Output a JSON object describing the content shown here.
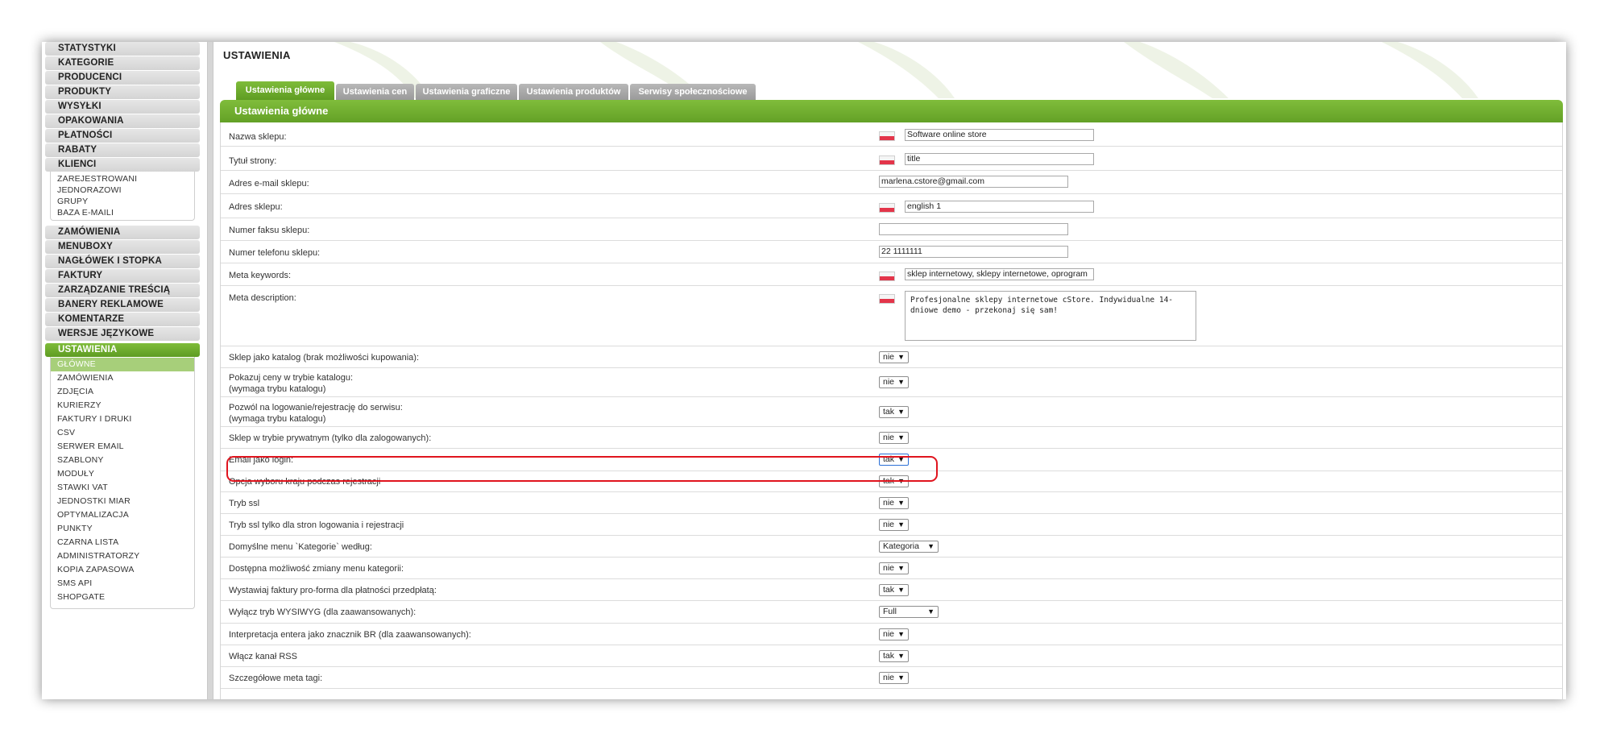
{
  "sidebar": {
    "sections_top": [
      "STATYSTYKI",
      "KATEGORIE",
      "PRODUCENCI",
      "PRODUKTY",
      "WYSYŁKI",
      "OPAKOWANIA",
      "PŁATNOŚCI",
      "RABATY",
      "KLIENCI"
    ],
    "klienci_items": [
      "ZAREJESTROWANI",
      "JEDNORAZOWI",
      "GRUPY",
      "BAZA E-MAILI"
    ],
    "sections_mid": [
      "ZAMÓWIENIA",
      "MENUBOXY",
      "NAGŁÓWEK I STOPKA",
      "FAKTURY",
      "ZARZĄDZANIE TREŚCIĄ",
      "BANERY REKLAMOWE",
      "KOMENTARZE",
      "WERSJE JĘZYKOWE"
    ],
    "active_section": "USTAWIENIA",
    "ustawienia_items": [
      "GŁÓWNE",
      "ZAMÓWIENIA",
      "ZDJĘCIA",
      "KURIERZY",
      "FAKTURY I DRUKI",
      "CSV",
      "SERWER EMAIL",
      "SZABLONY",
      "MODUŁY",
      "STAWKI VAT",
      "JEDNOSTKI MIAR",
      "OPTYMALIZACJA",
      "PUNKTY",
      "CZARNA LISTA",
      "ADMINISTRATORZY",
      "KOPIA ZAPASOWA",
      "SMS API",
      "SHOPGATE"
    ],
    "active_item": "GŁÓWNE"
  },
  "page": {
    "title": "USTAWIENIA"
  },
  "tabs": [
    "Ustawienia główne",
    "Ustawienia cen",
    "Ustawienia graficzne",
    "Ustawienia produktów",
    "Serwisy społecznościowe"
  ],
  "panel": {
    "header": "Ustawienia główne"
  },
  "fields": {
    "shop_name": {
      "label": "Nazwa sklepu:",
      "value": "Software online store"
    },
    "page_title": {
      "label": "Tytuł strony:",
      "value": "title"
    },
    "email": {
      "label": "Adres e-mail sklepu:",
      "value": "marlena.cstore@gmail.com"
    },
    "address": {
      "label": "Adres sklepu:",
      "value": "english 1"
    },
    "fax": {
      "label": "Numer faksu sklepu:",
      "value": ""
    },
    "phone": {
      "label": "Numer telefonu sklepu:",
      "value": "22 1111111"
    },
    "meta_keywords": {
      "label": "Meta keywords:",
      "value": "sklep internetowy, sklepy internetowe, oprogram"
    },
    "meta_description": {
      "label": "Meta description:",
      "value": "Profesjonalne sklepy internetowe cStore. Indywidualne 14-dniowe demo - przekonaj się sam!"
    }
  },
  "options": [
    {
      "label": "Sklep jako katalog (brak możliwości kupowania):",
      "value": "nie"
    },
    {
      "label": "Pokazuj ceny w trybie katalogu:",
      "label2": "(wymaga trybu katalogu)",
      "value": "nie"
    },
    {
      "label": "Pozwól na logowanie/rejestrację do serwisu:",
      "label2": "(wymaga trybu katalogu)",
      "value": "tak"
    },
    {
      "label": "Sklep w trybie prywatnym (tylko dla zalogowanych):",
      "value": "nie"
    },
    {
      "label": "Email jako login:",
      "value": "tak"
    },
    {
      "label": "Opcja wyboru kraju podczas rejestracji",
      "value": "tak"
    },
    {
      "label": "Tryb ssl",
      "value": "nie"
    },
    {
      "label": "Tryb ssl tylko dla stron logowania i rejestracji",
      "value": "nie"
    },
    {
      "label": "Domyślne menu `Kategorie` według:",
      "value": "Kategoria"
    },
    {
      "label": "Dostępna możliwość zmiany menu kategorii:",
      "value": "nie"
    },
    {
      "label": "Wystawiaj faktury pro-forma dla płatności przedpłatą:",
      "value": "tak"
    },
    {
      "label": "Wyłącz tryb WYSIWYG (dla zaawansowanych):",
      "value": "Full"
    },
    {
      "label": "Interpretacja entera jako znacznik BR (dla zaawansowanych):",
      "value": "nie"
    },
    {
      "label": "Włącz kanał RSS",
      "value": "tak"
    },
    {
      "label": "Szczegółowe meta tagi:",
      "value": "nie"
    }
  ],
  "colors": {
    "accent_green": "#6aa82c",
    "highlight_red": "#e0141e"
  },
  "icons": {
    "language_flag": "flag-pl-icon",
    "dropdown_arrow": "chevron-down-icon"
  }
}
